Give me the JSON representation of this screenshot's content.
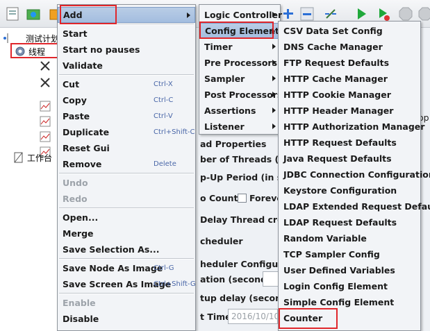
{
  "toolbar": {
    "icons": [
      "template-icon",
      "open-icon",
      "save-icon",
      "add-icon",
      "remove-icon",
      "expand-icon",
      "start-icon",
      "start-no-pause-icon",
      "stop-icon",
      "shutdown-icon"
    ]
  },
  "tree": {
    "test_plan_label": "测试计划",
    "thread_group_label": "线程",
    "workbench_label": "工作台"
  },
  "background": {
    "thread_properties": "ad Properties",
    "number_of_threads": "ber of Threads (use",
    "ramp_up": "p-Up Period (in seco",
    "loop_count": "o Count:",
    "forever": "Foreve",
    "delay_thread": "Delay Thread creati",
    "scheduler": "cheduler",
    "scheduler_config": "heduler Configuration",
    "duration": "ation (seconds)",
    "startup_delay": "tup delay (seconds)",
    "start_time": "t Time",
    "start_time_value": "2016/10/10",
    "op_fragment": "op"
  },
  "context_menu": {
    "items": [
      {
        "label": "Add",
        "submenu": true,
        "active": true
      },
      {
        "separator": true
      },
      {
        "label": "Start"
      },
      {
        "label": "Start no pauses"
      },
      {
        "label": "Validate"
      },
      {
        "separator": true
      },
      {
        "label": "Cut",
        "accel": "Ctrl-X"
      },
      {
        "label": "Copy",
        "accel": "Ctrl-C"
      },
      {
        "label": "Paste",
        "accel": "Ctrl-V"
      },
      {
        "label": "Duplicate",
        "accel": "Ctrl+Shift-C"
      },
      {
        "label": "Reset Gui"
      },
      {
        "label": "Remove",
        "accel": "Delete"
      },
      {
        "separator": true
      },
      {
        "label": "Undo",
        "disabled": true
      },
      {
        "label": "Redo",
        "disabled": true
      },
      {
        "separator": true
      },
      {
        "label": "Open..."
      },
      {
        "label": "Merge"
      },
      {
        "label": "Save Selection As..."
      },
      {
        "separator": true
      },
      {
        "label": "Save Node As Image",
        "accel": "Ctrl-G"
      },
      {
        "label": "Save Screen As Image",
        "accel": "Ctrl+Shift-G"
      },
      {
        "separator": true
      },
      {
        "label": "Enable",
        "disabled": true
      },
      {
        "label": "Disable"
      }
    ]
  },
  "add_menu": {
    "items": [
      {
        "label": "Logic Controller",
        "submenu": true
      },
      {
        "label": "Config Element",
        "submenu": true,
        "active": true
      },
      {
        "label": "Timer",
        "submenu": true
      },
      {
        "label": "Pre Processors",
        "submenu": true
      },
      {
        "label": "Sampler",
        "submenu": true
      },
      {
        "label": "Post Processors",
        "submenu": true
      },
      {
        "label": "Assertions",
        "submenu": true
      },
      {
        "label": "Listener",
        "submenu": true
      }
    ]
  },
  "config_menu": {
    "items": [
      "CSV Data Set Config",
      "DNS Cache Manager",
      "FTP Request Defaults",
      "HTTP Cache Manager",
      "HTTP Cookie Manager",
      "HTTP Header Manager",
      "HTTP Authorization Manager",
      "HTTP Request Defaults",
      "Java Request Defaults",
      "JDBC Connection Configuration",
      "Keystore Configuration",
      "LDAP Extended Request Defaults",
      "LDAP Request Defaults",
      "Random Variable",
      "TCP Sampler Config",
      "User Defined Variables",
      "Login Config Element",
      "Simple Config Element",
      "Counter"
    ]
  },
  "colors": {
    "highlight_box": "#e0262b",
    "menu_active": "#a3bddf",
    "accelerator": "#4a67a8"
  }
}
